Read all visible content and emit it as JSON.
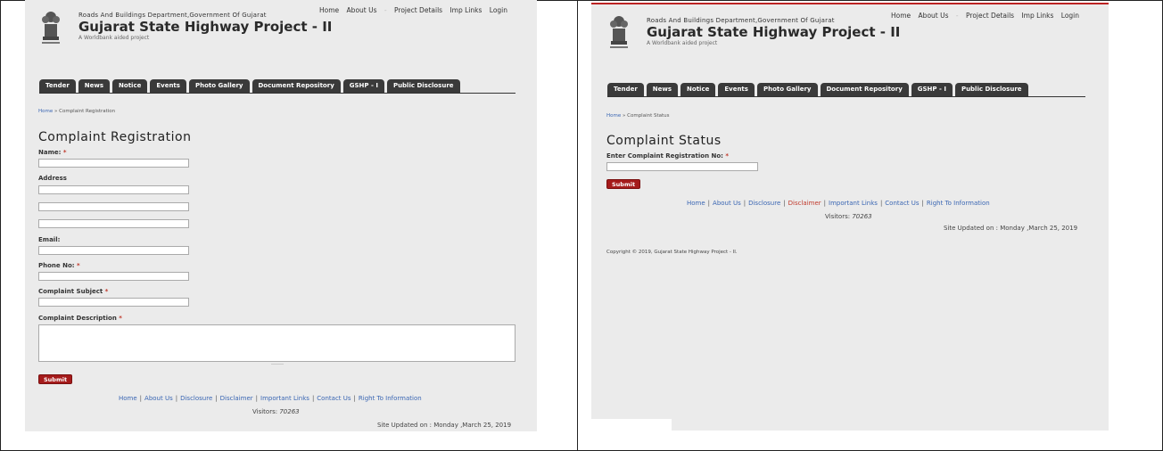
{
  "header": {
    "org": "Roads And Buildings Department,Government Of Gujarat",
    "brand": "Gujarat State Highway Project - II",
    "tagline": "A Worldbank aided project"
  },
  "topnav": [
    "Home",
    "About Us",
    "-",
    "Project Details",
    "Imp Links",
    "Login"
  ],
  "tabs": [
    "Tender",
    "News",
    "Notice",
    "Events",
    "Photo Gallery",
    "Document Repository",
    "GSHP - I",
    "Public Disclosure"
  ],
  "left": {
    "breadcrumb_home": "Home",
    "breadcrumb_sep": " » ",
    "breadcrumb_current": "Complaint Registration",
    "title": "Complaint Registration",
    "labels": {
      "name": "Name:",
      "address": "Address",
      "email": "Email:",
      "phone": "Phone No:",
      "subject": "Complaint Subject",
      "description": "Complaint Description"
    },
    "required_mark": "*",
    "submit": "Submit"
  },
  "right": {
    "breadcrumb_home": "Home",
    "breadcrumb_sep": " » ",
    "breadcrumb_current": "Complaint Status",
    "title": "Complaint Status",
    "label": "Enter Complaint Registration No:",
    "required_mark": "*",
    "submit": "Submit",
    "copyright": "Copyright © 2019, Gujarat State Highway Project - II."
  },
  "footer": {
    "links": [
      "Home",
      "About Us",
      "Disclosure",
      "Disclaimer",
      "Important Links",
      "Contact Us",
      "Right To Information"
    ],
    "visitors_label": "Visitors:",
    "visitors_count": "70263",
    "updated": "Site Updated on : Monday ,March 25, 2019"
  },
  "colors": {
    "tab_bg": "#3a3a3a",
    "accent_red": "#a51b1b",
    "link_blue": "#3a66b3",
    "page_bg": "#ebebeb"
  }
}
